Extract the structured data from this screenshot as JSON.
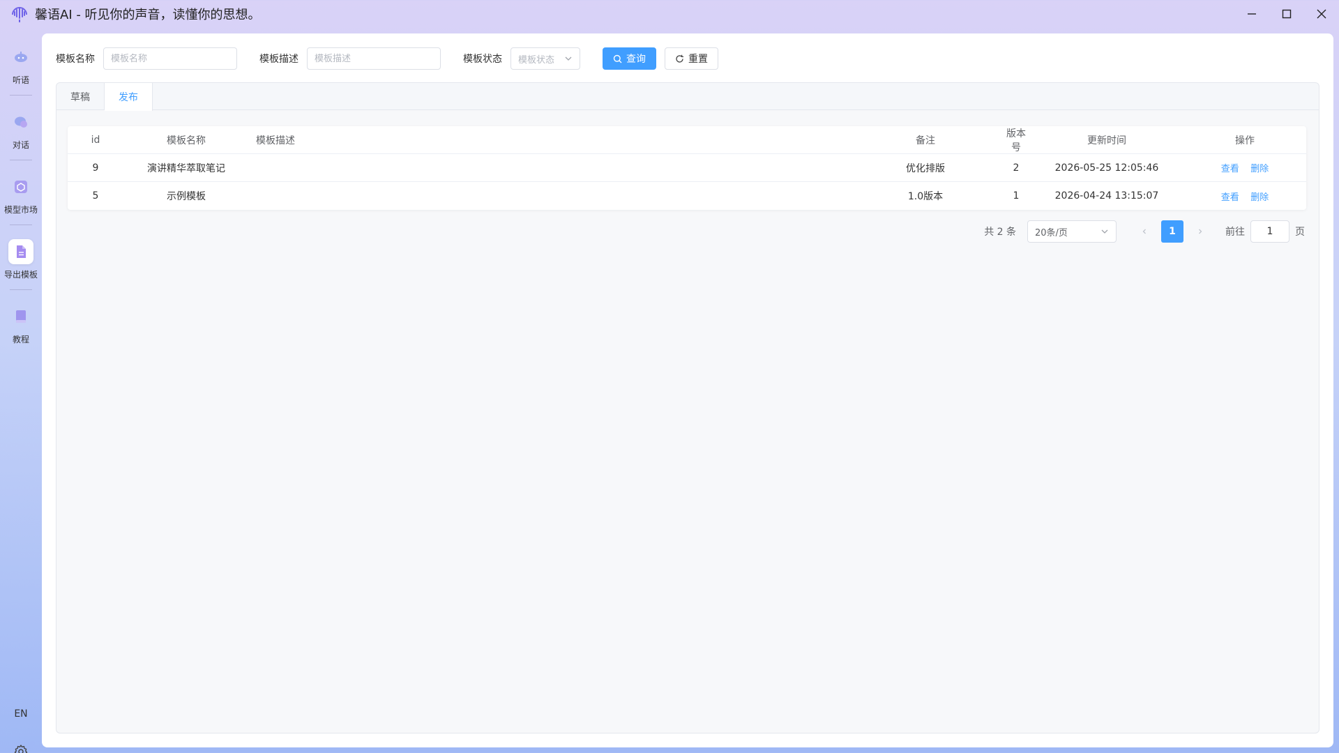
{
  "app": {
    "title": "馨语AI - 听见你的声音，读懂你的思想。",
    "accent_color": "#409eff"
  },
  "window_controls": [
    {
      "icon": "minimize-icon"
    },
    {
      "icon": "maximize-icon"
    },
    {
      "icon": "close-icon"
    }
  ],
  "sidebar": {
    "items": [
      {
        "label": "听语",
        "icon": "microphone-icon",
        "active": false
      },
      {
        "label": "对话",
        "icon": "chat-icon",
        "active": false
      },
      {
        "label": "模型市场",
        "icon": "cube-icon",
        "active": false
      },
      {
        "label": "导出模板",
        "icon": "document-icon",
        "active": true
      },
      {
        "label": "教程",
        "icon": "book-icon",
        "active": false
      }
    ],
    "language": "EN",
    "settings_icon": "gear-icon"
  },
  "filter": {
    "name_label": "模板名称",
    "name_placeholder": "模板名称",
    "desc_label": "模板描述",
    "desc_placeholder": "模板描述",
    "status_label": "模板状态",
    "status_placeholder": "模板状态",
    "query_button": "查询",
    "reset_button": "重置"
  },
  "tabs": [
    {
      "label": "草稿",
      "active": false
    },
    {
      "label": "发布",
      "active": true
    }
  ],
  "table": {
    "headers": {
      "id": "id",
      "name": "模板名称",
      "desc": "模板描述",
      "remark": "备注",
      "version": "版本号",
      "updated": "更新时间",
      "ops": "操作"
    },
    "rows": [
      {
        "id": "9",
        "name": "演讲精华萃取笔记",
        "desc": "",
        "remark": "优化排版",
        "version": "2",
        "updated": "2026-05-25 12:05:46",
        "view": "查看",
        "delete": "删除"
      },
      {
        "id": "5",
        "name": "示例模板",
        "desc": "",
        "remark": "1.0版本",
        "version": "1",
        "updated": "2026-04-24 13:15:07",
        "view": "查看",
        "delete": "删除"
      }
    ]
  },
  "pagination": {
    "total": "共 2 条",
    "page_size": "20条/页",
    "current_page": "1",
    "goto_label": "前往",
    "goto_value": "1",
    "page_suffix": "页"
  }
}
